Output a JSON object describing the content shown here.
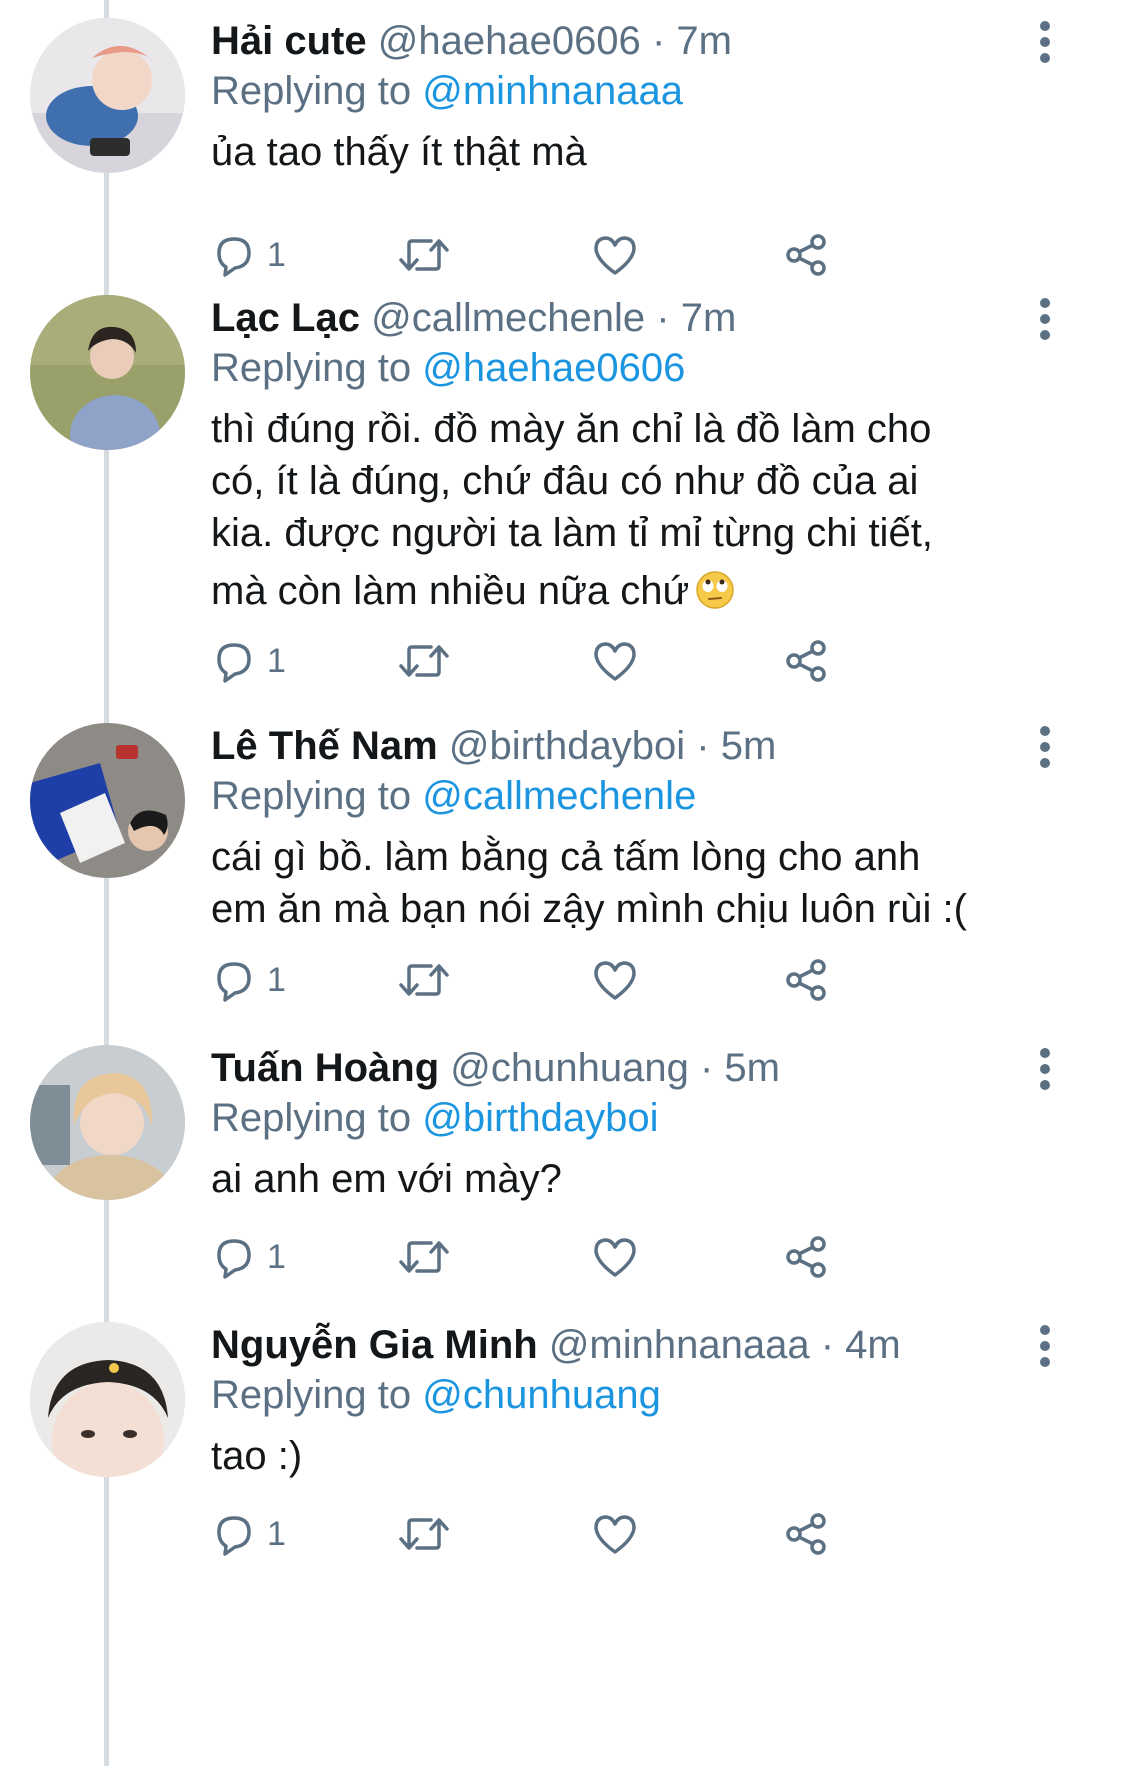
{
  "tweets": [
    {
      "display_name": "Hải cute",
      "handle": "@haehae0606",
      "separator": "·",
      "time": "7m",
      "replying_prefix": "Replying to",
      "replying_to": "@minhnanaaa",
      "lines": [
        "ủa tao thấy ít thật mà"
      ],
      "reply_count": "1"
    },
    {
      "display_name": "Lạc Lạc",
      "handle": "@callmechenle",
      "separator": "·",
      "time": "7m",
      "replying_prefix": "Replying to",
      "replying_to": "@haehae0606",
      "lines": [
        "thì đúng rồi. đồ mày ăn chỉ là đồ làm cho",
        "có, ít là đúng, chứ đâu có như đồ của ai",
        "kia. được người ta làm tỉ mỉ từng chi tiết,",
        "mà còn làm nhiều nữa chứ"
      ],
      "emoji": "face-with-rolling-eyes-emoji",
      "reply_count": "1"
    },
    {
      "display_name": "Lê Thế Nam",
      "handle": "@birthdayboi",
      "separator": "·",
      "time": "5m",
      "replying_prefix": "Replying to",
      "replying_to": "@callmechenle",
      "lines": [
        "cái gì bồ. làm bằng cả tấm lòng cho anh",
        "em ăn mà bạn nói zậy mình chịu luôn rùi :("
      ],
      "reply_count": "1"
    },
    {
      "display_name": "Tuấn Hoàng",
      "handle": "@chunhuang",
      "separator": "·",
      "time": "5m",
      "replying_prefix": "Replying to",
      "replying_to": "@birthdayboi",
      "lines": [
        "ai anh em với mày?"
      ],
      "reply_count": "1"
    },
    {
      "display_name": "Nguyễn Gia Minh",
      "handle": "@minhnanaaa",
      "separator": "·",
      "time": "4m",
      "replying_prefix": "Replying to",
      "replying_to": "@chunhuang",
      "lines": [
        "tao :)"
      ],
      "reply_count": "1"
    }
  ],
  "icons": {
    "reply": "reply-bubble-icon",
    "retweet": "retweet-icon",
    "like": "heart-icon",
    "share": "share-icon",
    "more": "more-vertical-icon"
  },
  "colors": {
    "name": "#14171a",
    "muted": "#5b7083",
    "link": "#1b95e0",
    "thread_line": "#d6dbe0",
    "icon": "#5b7083"
  }
}
